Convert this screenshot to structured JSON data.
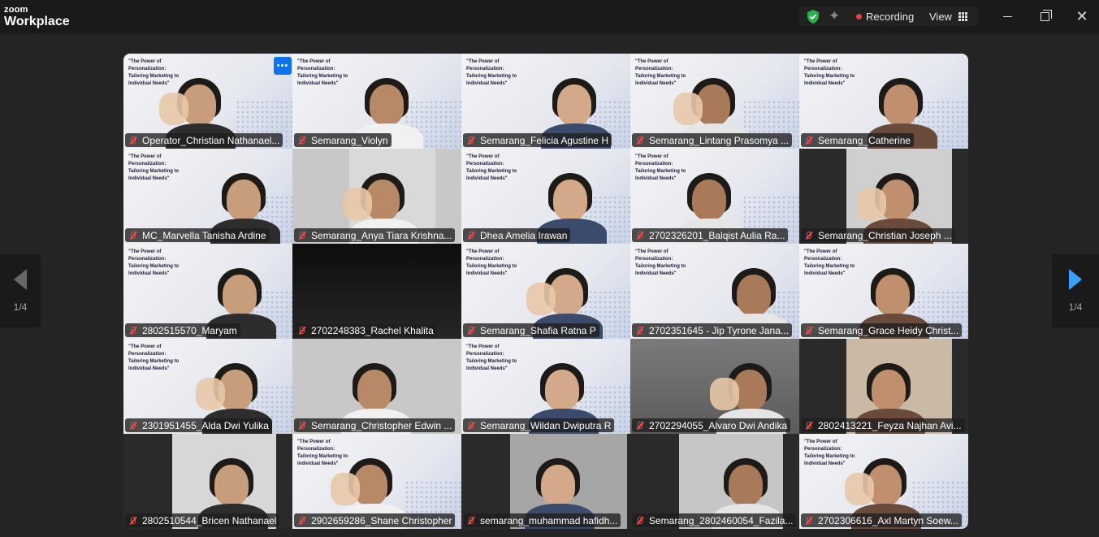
{
  "app": {
    "logo_top": "zoom",
    "logo_bottom": "Workplace"
  },
  "toolbar": {
    "recording_label": "Recording",
    "view_label": "View",
    "colors": {
      "recording_dot": "#e0443c",
      "shield": "#27b24a"
    }
  },
  "slide_text": "\"The Power of Personalization: Tailoring Marketing to Individual Needs\"",
  "participants": [
    {
      "name": "Operator_Christian Nathanael..."
    },
    {
      "name": "Semarang_Violyn"
    },
    {
      "name": "Semarang_Felicia Agustine H"
    },
    {
      "name": "Semarang_Lintang Prasomya ..."
    },
    {
      "name": "Semarang_Catherine"
    },
    {
      "name": "MC_Marvella Tanisha Ardine"
    },
    {
      "name": "Semarang_Anya Tiara Krishna..."
    },
    {
      "name": "Dhea Amelia Irawan"
    },
    {
      "name": "2702326201_Balqist Aulia Ra..."
    },
    {
      "name": "Semarang_Christian Joseph ..."
    },
    {
      "name": "2802515570_Maryam"
    },
    {
      "name": "2702248383_Rachel Khalita"
    },
    {
      "name": "Semarang_Shafia Ratna P"
    },
    {
      "name": "2702351645 - Jip Tyrone Jana..."
    },
    {
      "name": "Semarang_Grace Heidy Christ..."
    },
    {
      "name": "2301951455_Alda Dwi Yulika"
    },
    {
      "name": "Semarang_Christopher Edwin ..."
    },
    {
      "name": "Semarang_Wildan Dwiputra R"
    },
    {
      "name": "2702294055_Alvaro Dwi Andika"
    },
    {
      "name": "2802413221_Feyza Najhan Avi..."
    },
    {
      "name": "2802510544_Bricen Nathanael"
    },
    {
      "name": "2902659286_Shane Christopher"
    },
    {
      "name": "semarang_muhammad hafidh..."
    },
    {
      "name": "Semarang_2802460054_Fazila..."
    },
    {
      "name": "2702306616_Axl Martyn Soew..."
    }
  ],
  "pagination": {
    "left": "1/4",
    "right": "1/4"
  }
}
